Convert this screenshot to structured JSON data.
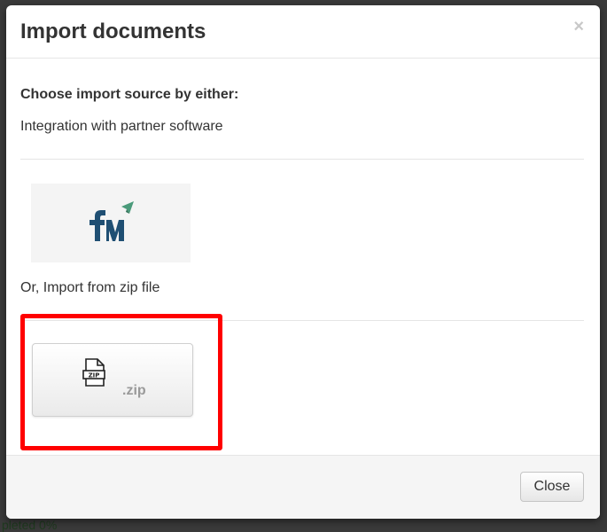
{
  "backdrop": {
    "partial_text_bottom": "pleted 0%"
  },
  "modal": {
    "title": "Import documents",
    "close_symbol": "×",
    "heading": "Choose import source by either:",
    "integration_text": "Integration with partner software",
    "partner_logo_icon": "fym-logo",
    "zip_option_text": "Or, Import from zip file",
    "zip_button": {
      "icon": "zip-file-icon",
      "icon_text": "ZIP",
      "label": ".zip"
    },
    "highlight_color": "#ff0000",
    "footer": {
      "close_label": "Close"
    }
  }
}
